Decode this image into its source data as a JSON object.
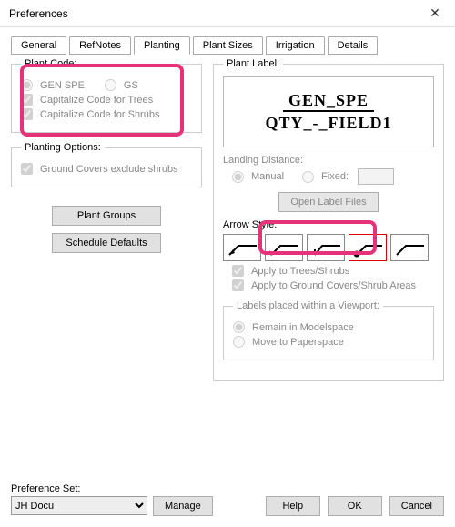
{
  "window": {
    "title": "Preferences"
  },
  "tabs": {
    "general": "General",
    "refnotes": "RefNotes",
    "planting": "Planting",
    "plantsizes": "Plant Sizes",
    "irrigation": "Irrigation",
    "details": "Details",
    "active": "planting"
  },
  "plant_code": {
    "legend": "Plant Code:",
    "opt_genspe": "GEN SPE",
    "opt_gs": "GS",
    "cap_trees": "Capitalize Code for Trees",
    "cap_shrubs": "Capitalize Code for Shrubs"
  },
  "planting_options": {
    "legend": "Planting Options:",
    "gc_exclude": "Ground Covers exclude shrubs"
  },
  "center_buttons": {
    "plant_groups": "Plant Groups",
    "schedule_defaults": "Schedule Defaults"
  },
  "plant_label": {
    "legend": "Plant Label:",
    "preview_line1": "GEN_SPE",
    "preview_line2": "QTY_-_FIELD1",
    "landing_legend": "Landing Distance:",
    "manual": "Manual",
    "fixed": "Fixed:",
    "open_label_files": "Open Label Files",
    "arrow_legend": "Arrow Style:",
    "apply_trees": "Apply to Trees/Shrubs",
    "apply_gc": "Apply to Ground Covers/Shrub Areas",
    "viewport_legend": "Labels placed within a Viewport:",
    "remain_ms": "Remain in Modelspace",
    "move_ps": "Move to Paperspace"
  },
  "prefset": {
    "label": "Preference Set:",
    "value": "JH Docu",
    "manage": "Manage"
  },
  "footer": {
    "help": "Help",
    "ok": "OK",
    "cancel": "Cancel"
  }
}
